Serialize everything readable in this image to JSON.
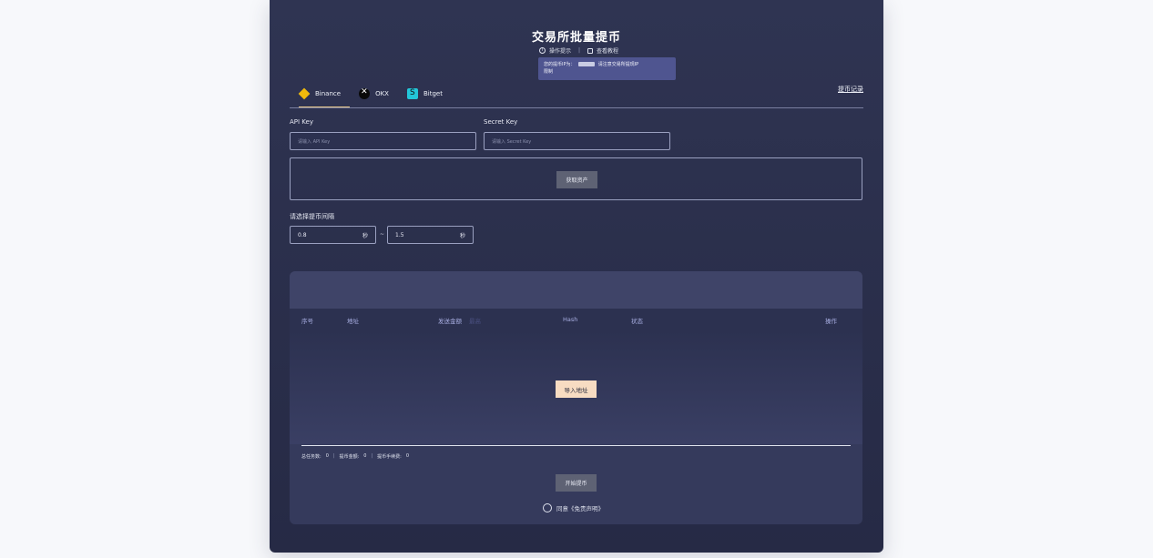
{
  "header": {
    "title": "交易所批量提币",
    "tips_label": "操作提示",
    "separator": "|",
    "tutorial_label": "查看教程"
  },
  "tooltip": {
    "line1_prefix": "您的提币IP为：",
    "line1_suffix": "请注意交易所提现IP",
    "line2": "限制"
  },
  "tabs": [
    {
      "label": "Binance",
      "icon": "binance-icon"
    },
    {
      "label": "OKX",
      "icon": "okx-icon"
    },
    {
      "label": "Bitget",
      "icon": "bitget-icon"
    }
  ],
  "records_link": "提币记录",
  "form": {
    "api_key_label": "API Key",
    "api_key_placeholder": "请输入 API Key",
    "secret_key_label": "Secret Key",
    "secret_key_placeholder": "请输入 Secret Key",
    "fetch_assets_button": "获取资产"
  },
  "interval": {
    "label": "请选择提币间隔",
    "min_value": "0.8",
    "max_value": "1.5",
    "unit": "秒",
    "tilde": "~"
  },
  "table": {
    "columns": [
      "序号",
      "地址",
      "发送金额",
      "Hash",
      "状态",
      "操作"
    ],
    "amount_hint": "最高",
    "import_button": "导入地址"
  },
  "stats": {
    "total_tasks_label": "总任务数:",
    "total_tasks_value": "0",
    "amount_label": "提币金额:",
    "amount_value": "0",
    "fee_label": "提币手续费:",
    "fee_value": "0",
    "pipe": "|"
  },
  "actions": {
    "start_button": "开始提币",
    "agree_label": "同意《免责声明》"
  }
}
